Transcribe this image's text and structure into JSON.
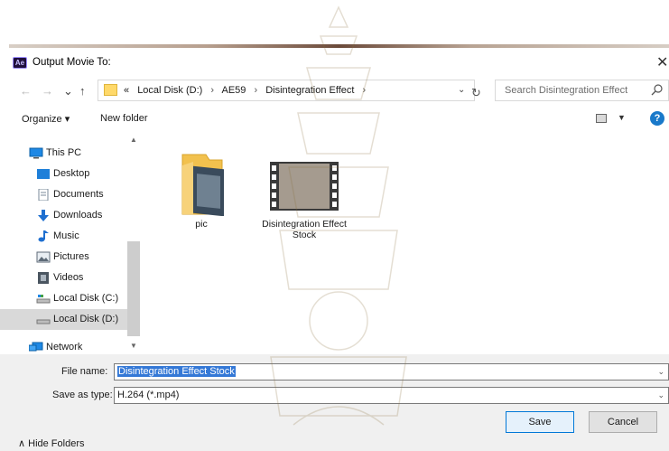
{
  "window": {
    "title": "Output Movie To:",
    "app_icon_text": "Ae"
  },
  "address": {
    "crumbs": [
      "«",
      "Local Disk (D:)",
      "AE59",
      "Disintegration Effect"
    ],
    "separator": "›"
  },
  "search": {
    "placeholder": "Search Disintegration Effect"
  },
  "toolbar": {
    "organize": "Organize ▾",
    "new_folder": "New folder",
    "help": "?"
  },
  "nav": {
    "items": [
      {
        "label": "This PC",
        "icon": "pc-icon"
      },
      {
        "label": "Desktop",
        "icon": "desktop-icon"
      },
      {
        "label": "Documents",
        "icon": "documents-icon"
      },
      {
        "label": "Downloads",
        "icon": "downloads-icon"
      },
      {
        "label": "Music",
        "icon": "music-icon"
      },
      {
        "label": "Pictures",
        "icon": "pictures-icon"
      },
      {
        "label": "Videos",
        "icon": "videos-icon"
      },
      {
        "label": "Local Disk (C:)",
        "icon": "drive-c-icon"
      },
      {
        "label": "Local Disk (D:)",
        "icon": "drive-d-icon",
        "selected": true
      },
      {
        "label": "Network",
        "icon": "network-icon"
      }
    ]
  },
  "files": [
    {
      "name": "pic",
      "type": "folder"
    },
    {
      "name": "Disintegration Effect Stock",
      "type": "video"
    }
  ],
  "footer": {
    "file_name_label": "File name:",
    "file_name_value": "Disintegration Effect Stock",
    "save_type_label": "Save as type:",
    "save_type_value": "H.264 (*.mp4)",
    "hide_folders": "Hide Folders",
    "save": "Save",
    "cancel": "Cancel"
  }
}
